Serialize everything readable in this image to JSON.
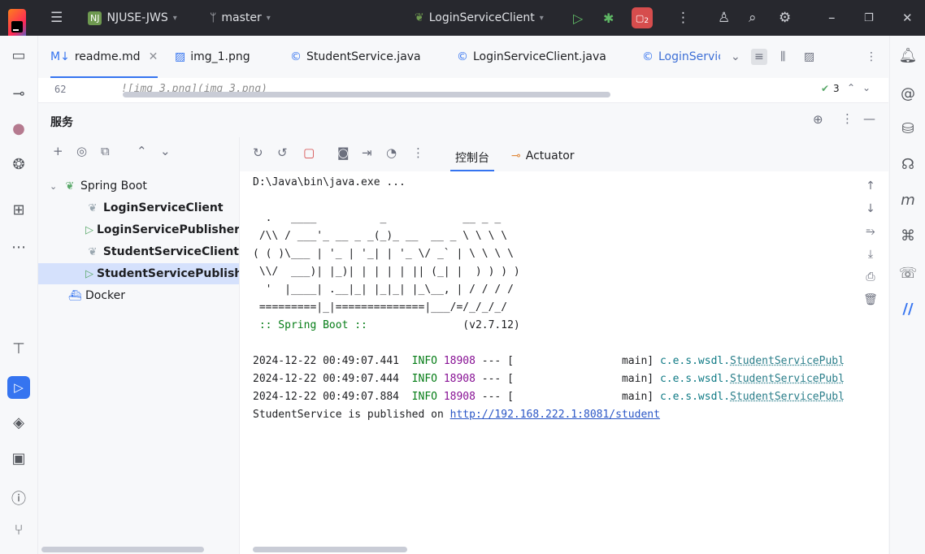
{
  "titlebar": {
    "project_badge": "NJ",
    "project_name": "NJUSE-JWS",
    "branch": "master",
    "run_config": "LoginServiceClient",
    "run_chip": "2"
  },
  "tabs": [
    {
      "label": "readme.md",
      "icon": "markdown-icon",
      "active": true
    },
    {
      "label": "img_1.png",
      "icon": "image-icon"
    },
    {
      "label": "StudentService.java",
      "icon": "class-icon"
    },
    {
      "label": "LoginServiceClient.java",
      "icon": "class-icon"
    },
    {
      "label": "LoginServiceP",
      "icon": "class-icon"
    }
  ],
  "editor": {
    "line_number": "62",
    "line_text": "![img_3.png](img_3.png)",
    "warning_count": "3"
  },
  "services": {
    "title": "服务",
    "tree": [
      {
        "label": "Spring Boot",
        "level": 0,
        "icon": "spring-boot-icon"
      },
      {
        "label": "LoginServiceClient",
        "level": 1,
        "icon": "spring-leaf-icon"
      },
      {
        "label": "LoginServicePublisher",
        "level": 1,
        "icon": "run-icon"
      },
      {
        "label": "StudentServiceClient",
        "level": 1,
        "icon": "spring-leaf-icon"
      },
      {
        "label": "StudentServicePublisher",
        "level": 1,
        "icon": "run-icon",
        "selected": true
      },
      {
        "label": "Docker",
        "level": 0,
        "icon": "docker-icon"
      }
    ]
  },
  "console": {
    "tab_console": "控制台",
    "tab_actuator": "Actuator",
    "cmd": "D:\\Java\\bin\\java.exe ...",
    "banner": [
      "  .   ____          _            __ _ _",
      " /\\\\ / ___'_ __ _ _(_)_ __  __ _ \\ \\ \\ \\",
      "( ( )\\___ | '_ | '_| | '_ \\/ _` | \\ \\ \\ \\",
      " \\\\/  ___)| |_)| | | | | || (_| |  ) ) ) )",
      "  '  |____| .__|_| |_|_| |_\\__, | / / / /",
      " =========|_|==============|___/=/_/_/_/"
    ],
    "spring_boot_label": " :: Spring Boot ::",
    "spring_boot_version": "(v2.7.12)",
    "logs": [
      {
        "time": "2024-12-22 00:49:07.441",
        "level": "INFO",
        "pid": "18908",
        "sep": "--- [",
        "thread": "main]",
        "logger_prefix": "c.e.s.wsdl.",
        "logger": "StudentServicePubl"
      },
      {
        "time": "2024-12-22 00:49:07.444",
        "level": "INFO",
        "pid": "18908",
        "sep": "--- [",
        "thread": "main]",
        "logger_prefix": "c.e.s.wsdl.",
        "logger": "StudentServicePubl"
      },
      {
        "time": "2024-12-22 00:49:07.884",
        "level": "INFO",
        "pid": "18908",
        "sep": "--- [",
        "thread": "main]",
        "logger_prefix": "c.e.s.wsdl.",
        "logger": "StudentServicePubl"
      }
    ],
    "published_text": "StudentService is published on ",
    "published_url": "http://192.168.222.1:8081/student"
  }
}
